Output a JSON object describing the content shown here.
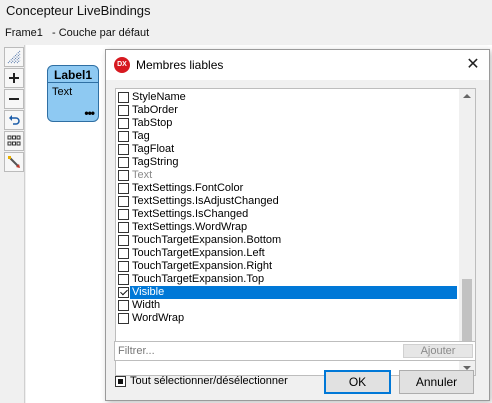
{
  "designer": {
    "title": "Concepteur LiveBindings",
    "frame_name": "Frame1",
    "layer_label": "- Couche par défaut",
    "toolbar": [
      {
        "icon": "arrange-icon"
      },
      {
        "icon": "zoom-in-icon",
        "glyph": "+"
      },
      {
        "icon": "zoom-out-icon",
        "glyph": "−"
      },
      {
        "icon": "undo-icon",
        "glyph": "↶"
      },
      {
        "icon": "grid-icon",
        "glyph": "▦"
      },
      {
        "icon": "wand-icon",
        "glyph": "✎"
      }
    ],
    "component": {
      "name": "Label1",
      "member": "Text",
      "more": "•••"
    }
  },
  "dialog": {
    "icon_text": "DX",
    "title": "Membres liables",
    "close_glyph": "✕",
    "items": [
      {
        "label": "StyleName",
        "checked": false,
        "disabled": false
      },
      {
        "label": "TabOrder",
        "checked": false,
        "disabled": false
      },
      {
        "label": "TabStop",
        "checked": false,
        "disabled": false
      },
      {
        "label": "Tag",
        "checked": false,
        "disabled": false
      },
      {
        "label": "TagFloat",
        "checked": false,
        "disabled": false
      },
      {
        "label": "TagString",
        "checked": false,
        "disabled": false
      },
      {
        "label": "Text",
        "checked": false,
        "disabled": true
      },
      {
        "label": "TextSettings.FontColor",
        "checked": false,
        "disabled": false
      },
      {
        "label": "TextSettings.IsAdjustChanged",
        "checked": false,
        "disabled": false
      },
      {
        "label": "TextSettings.IsChanged",
        "checked": false,
        "disabled": false
      },
      {
        "label": "TextSettings.WordWrap",
        "checked": false,
        "disabled": false
      },
      {
        "label": "TouchTargetExpansion.Bottom",
        "checked": false,
        "disabled": false
      },
      {
        "label": "TouchTargetExpansion.Left",
        "checked": false,
        "disabled": false
      },
      {
        "label": "TouchTargetExpansion.Right",
        "checked": false,
        "disabled": false
      },
      {
        "label": "TouchTargetExpansion.Top",
        "checked": false,
        "disabled": false
      },
      {
        "label": "Visible",
        "checked": true,
        "disabled": false,
        "selected": true
      },
      {
        "label": "Width",
        "checked": false,
        "disabled": false
      },
      {
        "label": "WordWrap",
        "checked": false,
        "disabled": false
      }
    ],
    "filter_placeholder": "Filtrer...",
    "add_label": "Ajouter",
    "select_all_label": "Tout sélectionner/désélectionner",
    "ok_label": "OK",
    "cancel_label": "Annuler",
    "accent_color": "#0078d7"
  }
}
